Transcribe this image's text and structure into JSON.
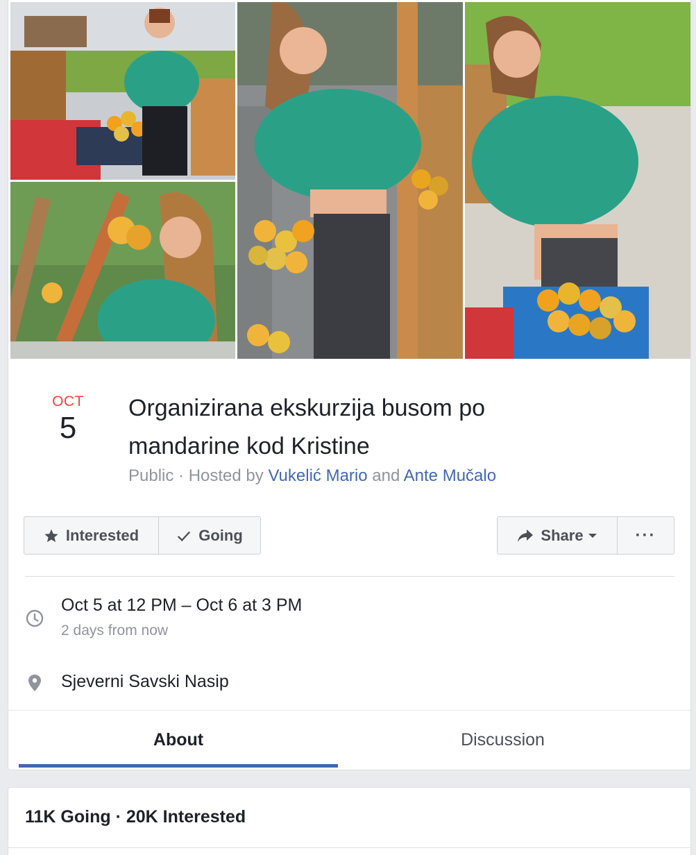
{
  "event": {
    "date": {
      "month": "OCT",
      "day": "5"
    },
    "title": "Organizirana ekskurzija busom po mandarine kod Kristine",
    "meta": {
      "privacy": "Public",
      "separator": " · ",
      "hosted_by": "Hosted by ",
      "host1": "Vukelić Mario",
      "and": " and ",
      "host2": "Ante Mučalo"
    }
  },
  "buttons": {
    "interested": "Interested",
    "going": "Going",
    "share": "Share",
    "more": "···"
  },
  "details": {
    "time": "Oct 5 at 12 PM – Oct 6 at 3 PM",
    "time_relative": "2 days from now",
    "location": "Sjeverni Savski Nasip"
  },
  "tabs": [
    {
      "label": "About",
      "active": true
    },
    {
      "label": "Discussion",
      "active": false
    }
  ],
  "stats": {
    "summary": "11K Going · 20K Interested"
  },
  "icons": {
    "interested": "star-icon",
    "going": "check-icon",
    "share": "share-arrow-icon",
    "share_dropdown": "caret-down-icon",
    "time": "clock-icon",
    "location": "map-pin-icon"
  },
  "colors": {
    "accent": "#4267b2",
    "date_month": "#fa3e3e",
    "secondary_text": "#90949c"
  }
}
